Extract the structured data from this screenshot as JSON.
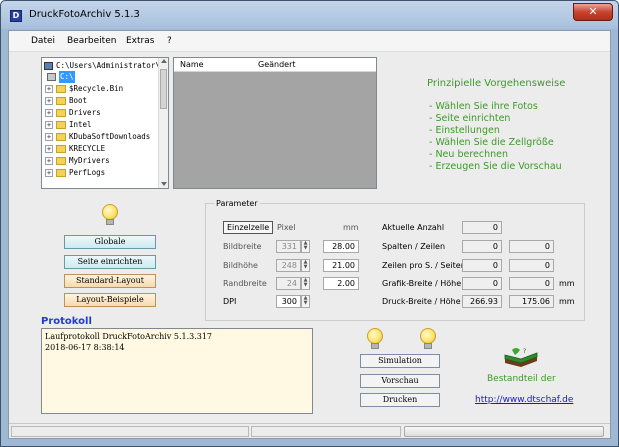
{
  "window": {
    "title": "DruckFotoArchiv  5.1.3",
    "icon_letter": "D"
  },
  "menu": [
    "Datei",
    "Bearbeiten",
    "Extras",
    "?"
  ],
  "tree": {
    "root": "C:\\Users\\Administrator\\",
    "selected": "C:\\",
    "items": [
      "$Recycle.Bin",
      "Boot",
      "Drivers",
      "Intel",
      "KDubaSoftDownloads",
      "KRECYCLE",
      "MyDrivers",
      "PerfLogs"
    ]
  },
  "listview": {
    "columns": [
      "Name",
      "Geändert"
    ]
  },
  "info": {
    "title": "Prinzipielle Vorgehensweise",
    "steps": [
      "- Wählen Sie ihre Fotos",
      "- Seite einrichten",
      "- Einstellungen",
      "- Wählen Sie die Zellgröße",
      "- Neu berechnen",
      "- Erzeugen Sie die Vorschau"
    ]
  },
  "left_buttons": {
    "globale": "Globale",
    "seite": "Seite einrichten",
    "standard": "Standard-Layout",
    "beispiele": "Layout-Beispiele"
  },
  "parameter": {
    "group_title": "Parameter",
    "einzelzelle": "Einzelzelle",
    "pixel_header": "Pixel",
    "mm_header": "mm",
    "rows": [
      {
        "label": "Bildbreite",
        "pixel": "331",
        "mm": "28.00"
      },
      {
        "label": "Bildhöhe",
        "pixel": "248",
        "mm": "21.00"
      },
      {
        "label": "Randbreite",
        "pixel": "24",
        "mm": "2.00"
      },
      {
        "label": "DPI",
        "pixel": "300"
      }
    ],
    "right_rows": [
      {
        "label": "Aktuelle Anzahl",
        "v1": "0"
      },
      {
        "label": "Spalten / Zeilen",
        "v1": "0",
        "v2": "0"
      },
      {
        "label": "Zeilen pro S. / Seiten",
        "v1": "0",
        "v2": "0"
      },
      {
        "label": "Grafik-Breite / Höhe",
        "v1": "0",
        "v2": "0",
        "unit": "mm"
      },
      {
        "label": "Druck-Breite / Höhe",
        "v1": "266.93",
        "v2": "175.06",
        "unit": "mm"
      }
    ]
  },
  "protocol": {
    "title": "Protokoll",
    "lines": [
      "Laufprotokoll DruckFotoArchiv 5.1.3.317",
      "2018-06-17 8:38:14"
    ]
  },
  "bottom_buttons": {
    "simulation": "Simulation",
    "vorschau": "Vorschau",
    "drucken": "Drucken"
  },
  "bestandteil": "Bestandteil der",
  "link": "http://www.dtschaf.de",
  "colors": {
    "accent_green": "#3c9a28",
    "protocol_blue": "#1c3bd8",
    "link_blue": "#1a1acd"
  }
}
